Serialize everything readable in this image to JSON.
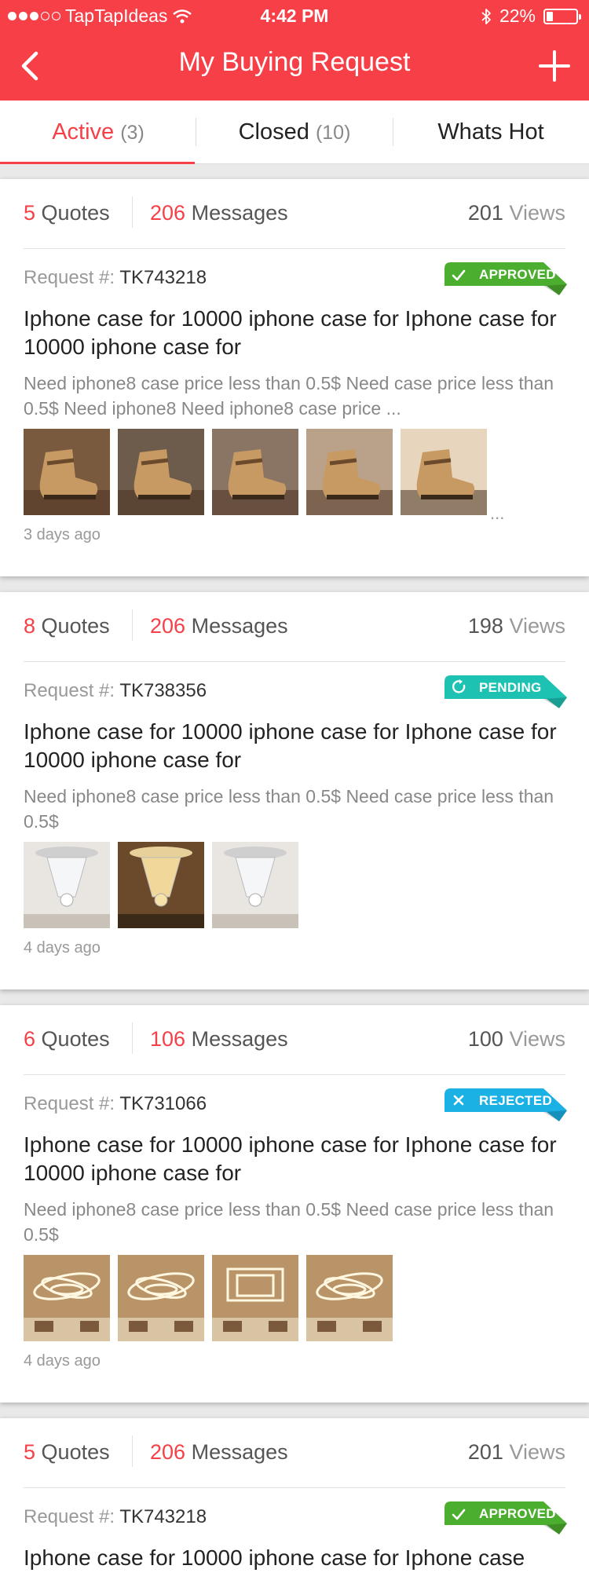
{
  "status_bar": {
    "carrier": "TapTapIdeas",
    "time": "4:42 PM",
    "battery": "22%",
    "battery_level": 0.22
  },
  "nav": {
    "title": "My Buying Request",
    "back_icon": "chevron-left-icon",
    "add_icon": "plus-icon"
  },
  "tabs": [
    {
      "label": "Active",
      "count": "(3)"
    },
    {
      "label": "Closed",
      "count": "(10)"
    },
    {
      "label": "Whats Hot",
      "count": ""
    }
  ],
  "labels": {
    "quotes": "Quotes",
    "messages": "Messages",
    "views": "Views",
    "request": "Request #:"
  },
  "colors": {
    "brand": "#f63f47",
    "approved": "#4cae2e",
    "pending": "#1ec2b3",
    "rejected": "#1cb1e4"
  },
  "requests": [
    {
      "quotes": "5",
      "messages": "206",
      "views": "201",
      "id": "TK743218",
      "status": "APPROVED",
      "status_icon": "check-icon",
      "title": "Iphone case for 10000 iphone case for Iphone case for 10000 iphone case for",
      "desc": "Need iphone8 case price less than 0.5$ Need case price less than 0.5$ Need iphone8 Need iphone8 case price ...",
      "images": [
        "boot-photo-1",
        "boot-photo-2",
        "boot-photo-3",
        "boot-photo-4",
        "boot-photo-5"
      ],
      "more": "...",
      "time": "3 days ago"
    },
    {
      "quotes": "8",
      "messages": "206",
      "views": "198",
      "id": "TK738356",
      "status": "PENDING",
      "status_icon": "refresh-icon",
      "title": "Iphone case for 10000 iphone case for Iphone case for 10000 iphone case for",
      "desc": "Need iphone8 case price less than 0.5$ Need case price less than 0.5$",
      "images": [
        "chandelier-photo-1",
        "chandelier-photo-2",
        "chandelier-photo-3"
      ],
      "more": "",
      "time": "4 days ago"
    },
    {
      "quotes": "6",
      "messages": "106",
      "views": "100",
      "id": "TK731066",
      "status": "REJECTED",
      "status_icon": "close-icon",
      "title": "Iphone case for 10000 iphone case for Iphone case for 10000 iphone case for",
      "desc": "Need iphone8 case price less than 0.5$ Need case price less than 0.5$",
      "images": [
        "ring-lamp-photo-1",
        "ring-lamp-photo-2",
        "ring-lamp-photo-3",
        "ring-lamp-photo-4"
      ],
      "more": "",
      "time": "4 days ago"
    },
    {
      "quotes": "5",
      "messages": "206",
      "views": "201",
      "id": "TK743218",
      "status": "APPROVED",
      "status_icon": "check-icon",
      "title": "Iphone case for 10000 iphone case for Iphone case",
      "desc": "",
      "images": [],
      "more": "",
      "time": ""
    }
  ]
}
